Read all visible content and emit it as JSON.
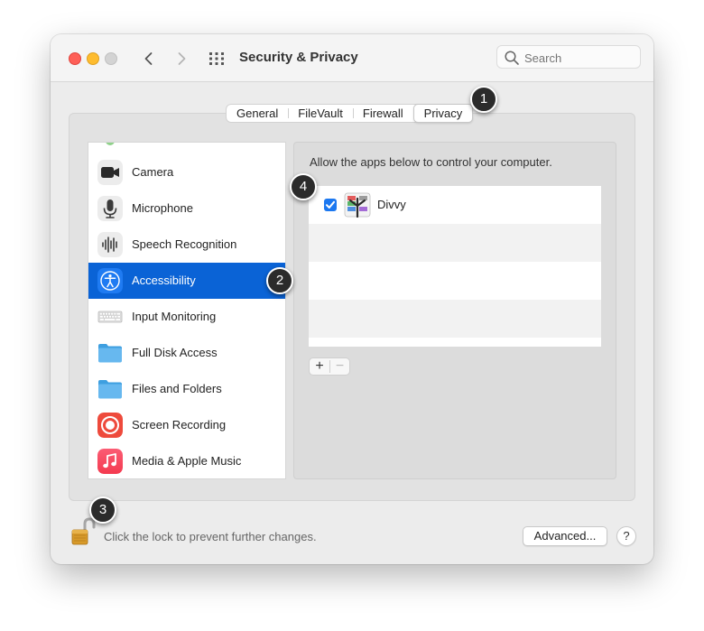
{
  "window": {
    "title": "Security & Privacy",
    "search_placeholder": "Search"
  },
  "tabs": [
    {
      "label": "General",
      "selected": false
    },
    {
      "label": "FileVault",
      "selected": false
    },
    {
      "label": "Firewall",
      "selected": false
    },
    {
      "label": "Privacy",
      "selected": true
    }
  ],
  "categories": [
    {
      "label": "Camera",
      "icon": "camera-icon"
    },
    {
      "label": "Microphone",
      "icon": "microphone-icon"
    },
    {
      "label": "Speech Recognition",
      "icon": "waveform-icon"
    },
    {
      "label": "Accessibility",
      "icon": "accessibility-icon",
      "selected": true
    },
    {
      "label": "Input Monitoring",
      "icon": "keyboard-icon"
    },
    {
      "label": "Full Disk Access",
      "icon": "folder-icon"
    },
    {
      "label": "Files and Folders",
      "icon": "folder-icon"
    },
    {
      "label": "Screen Recording",
      "icon": "record-icon"
    },
    {
      "label": "Media & Apple Music",
      "icon": "music-note-icon"
    }
  ],
  "detail": {
    "description": "Allow the apps below to control your computer.",
    "apps": [
      {
        "name": "Divvy",
        "checked": true
      }
    ],
    "add_label": "+",
    "remove_label": "−"
  },
  "footer": {
    "lock_text": "Click the lock to prevent further changes.",
    "advanced_label": "Advanced...",
    "help_label": "?"
  },
  "callouts": [
    "1",
    "2",
    "3",
    "4"
  ],
  "colors": {
    "selection": "#0a63d6",
    "checkbox": "#1c78f0",
    "close": "#fe5f57",
    "minimize": "#febc2e"
  }
}
